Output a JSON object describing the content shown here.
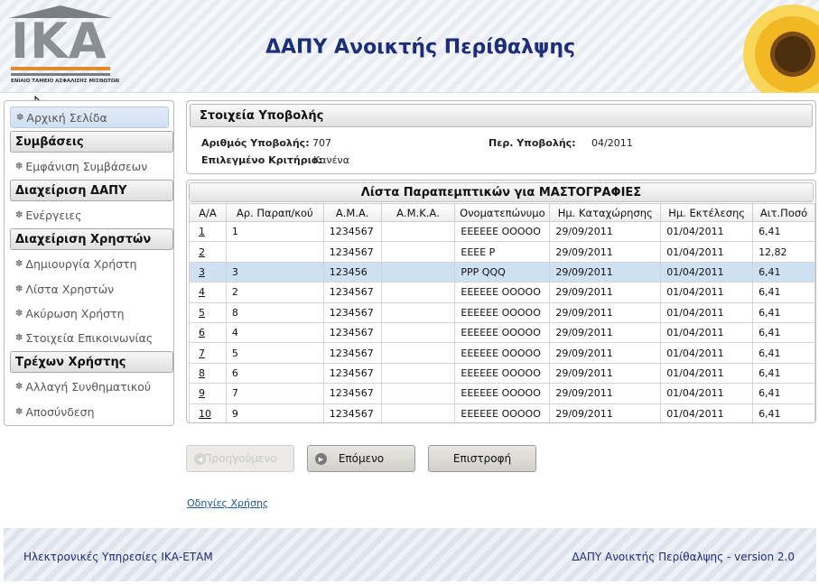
{
  "header": {
    "logo_text": "ΙΚΑ",
    "logo_subtitle": "ΕΝΙΑΙΟ ΤΑΜΕΙΟ ΑΣΦΑΛΙΣΗΣ ΜΙΣΘΩΤΩΝ",
    "title": "ΔΑΠΥ Ανοικτής Περίθαλψης"
  },
  "sidebar": {
    "home": "Αρχική Σελίδα",
    "sections": [
      {
        "title": "Συμβάσεις",
        "items": [
          "Εμφάνιση Συμβάσεων"
        ]
      },
      {
        "title": "Διαχείριση ΔΑΠΥ",
        "items": [
          "Ενέργειες"
        ]
      },
      {
        "title": "Διαχείριση Χρηστών",
        "items": [
          "Δημιουργία Χρήστη",
          "Λίστα Χρηστών",
          "Ακύρωση Χρήστη",
          "Στοιχεία Επικοινωνίας"
        ]
      },
      {
        "title": "Τρέχων Χρήστης",
        "items": [
          "Αλλαγή Συνθηματικού",
          "Αποσύνδεση"
        ]
      }
    ]
  },
  "submission": {
    "title": "Στοιχεία Υποβολής",
    "number_label": "Αριθμός Υποβολής:",
    "number_value": "707",
    "period_label": "Περ. Υποβολής:",
    "period_value": "04/2011",
    "criterion_label": "Επιλεγμένο Κριτήριο:",
    "criterion_value": "Κανένα"
  },
  "list": {
    "title": "Λίστα Παραπεμπτικών για ΜΑΣΤΟΓΡΑΦΙΕΣ",
    "columns": [
      "Α/Α",
      "Αρ. Παραπ/κού",
      "Α.Μ.Α.",
      "Α.Μ.Κ.Α.",
      "Ονοματεπώνυμο",
      "Ημ. Καταχώρησης",
      "Ημ. Εκτέλεσης",
      "Αιτ.Ποσό"
    ],
    "selected_row": 2,
    "rows": [
      [
        "1",
        "1",
        "1234567",
        "",
        "ΕΕΕΕΕΕ ΟΟΟΟΟ",
        "29/09/2011",
        "01/04/2011",
        "6,41"
      ],
      [
        "2",
        "",
        "1234567",
        "",
        "ΕΕΕΕ Ρ",
        "29/09/2011",
        "01/04/2011",
        "12,82"
      ],
      [
        "3",
        "3",
        "123456",
        "",
        "ΡΡΡ QQQ",
        "29/09/2011",
        "01/04/2011",
        "6,41"
      ],
      [
        "4",
        "2",
        "1234567",
        "",
        "ΕΕΕΕΕΕ ΟΟΟΟΟ",
        "29/09/2011",
        "01/04/2011",
        "6,41"
      ],
      [
        "5",
        "8",
        "1234567",
        "",
        "ΕΕΕΕΕΕ ΟΟΟΟΟ",
        "29/09/2011",
        "01/04/2011",
        "6,41"
      ],
      [
        "6",
        "4",
        "1234567",
        "",
        "ΕΕΕΕΕΕ ΟΟΟΟΟ",
        "29/09/2011",
        "01/04/2011",
        "6,41"
      ],
      [
        "7",
        "5",
        "1234567",
        "",
        "ΕΕΕΕΕΕ ΟΟΟΟΟ",
        "29/09/2011",
        "01/04/2011",
        "6,41"
      ],
      [
        "8",
        "6",
        "1234567",
        "",
        "ΕΕΕΕΕΕ ΟΟΟΟΟ",
        "29/09/2011",
        "01/04/2011",
        "6,41"
      ],
      [
        "9",
        "7",
        "1234567",
        "",
        "ΕΕΕΕΕΕ ΟΟΟΟΟ",
        "29/09/2011",
        "01/04/2011",
        "6,41"
      ],
      [
        "10",
        "9",
        "1234567",
        "",
        "ΕΕΕΕΕΕ ΟΟΟΟΟ",
        "29/09/2011",
        "01/04/2011",
        "6,41"
      ]
    ]
  },
  "buttons": {
    "previous": "Προηγούμενο",
    "next": "Επόμενο",
    "back": "Επιστροφή"
  },
  "help_link": "Οδηγίες Χρήσης",
  "footer": {
    "left": "Ηλεκτρονικές Υπηρεσίες ΙΚΑ-ΕΤΑΜ",
    "right": "ΔΑΠΥ Ανοικτής Περίθαλψης - version 2.0"
  },
  "colors": {
    "title_blue": "#1c2d7a",
    "selected_row": "#cfe0f3",
    "logo_orange": "#e08a2c"
  }
}
